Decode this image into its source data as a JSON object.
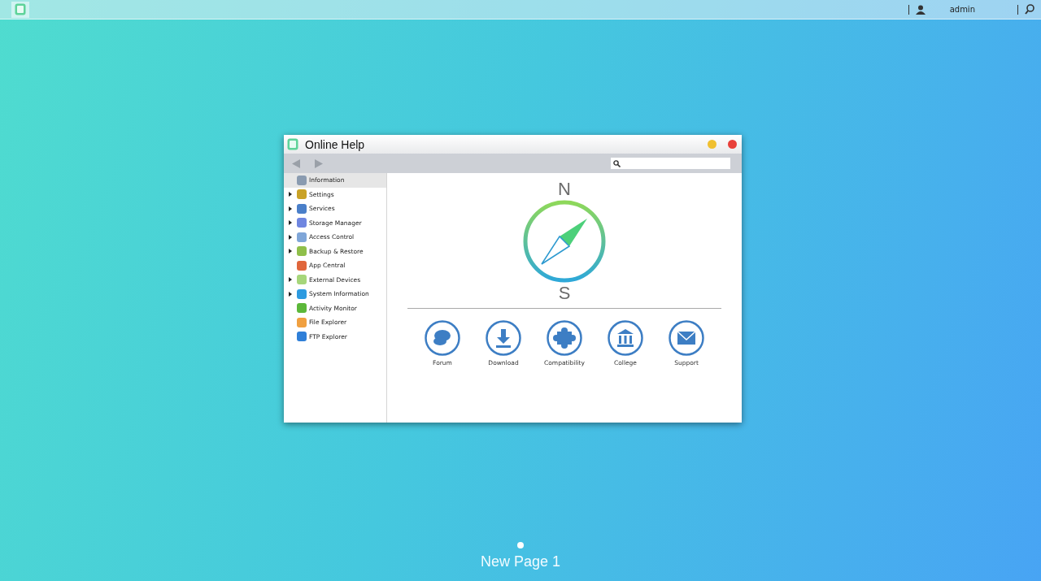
{
  "top_bar": {
    "user": "admin"
  },
  "window": {
    "title": "Online Help",
    "sidebar": {
      "items": [
        {
          "label": "Information",
          "selected": true,
          "expandable": false,
          "color": "#8a9bb0"
        },
        {
          "label": "Settings",
          "selected": false,
          "expandable": true,
          "color": "#c9a227"
        },
        {
          "label": "Services",
          "selected": false,
          "expandable": true,
          "color": "#4a7fc9"
        },
        {
          "label": "Storage Manager",
          "selected": false,
          "expandable": true,
          "color": "#6f86e0"
        },
        {
          "label": "Access Control",
          "selected": false,
          "expandable": true,
          "color": "#7fa6d8"
        },
        {
          "label": "Backup & Restore",
          "selected": false,
          "expandable": true,
          "color": "#8fbf4a"
        },
        {
          "label": "App Central",
          "selected": false,
          "expandable": false,
          "color": "#e0663c"
        },
        {
          "label": "External Devices",
          "selected": false,
          "expandable": true,
          "color": "#a6d67a"
        },
        {
          "label": "System Information",
          "selected": false,
          "expandable": true,
          "color": "#2e9be0"
        },
        {
          "label": "Activity Monitor",
          "selected": false,
          "expandable": false,
          "color": "#5cb83a"
        },
        {
          "label": "File Explorer",
          "selected": false,
          "expandable": false,
          "color": "#f0a040"
        },
        {
          "label": "FTP Explorer",
          "selected": false,
          "expandable": false,
          "color": "#2f7fd8"
        }
      ]
    },
    "compass": {
      "north": "N",
      "south": "S"
    },
    "links": [
      {
        "label": "Forum",
        "kind": "forum"
      },
      {
        "label": "Download",
        "kind": "download"
      },
      {
        "label": "Compatibility",
        "kind": "puzzle"
      },
      {
        "label": "College",
        "kind": "college"
      },
      {
        "label": "Support",
        "kind": "mail"
      }
    ]
  },
  "desktop": {
    "page_label": "New Page 1"
  }
}
